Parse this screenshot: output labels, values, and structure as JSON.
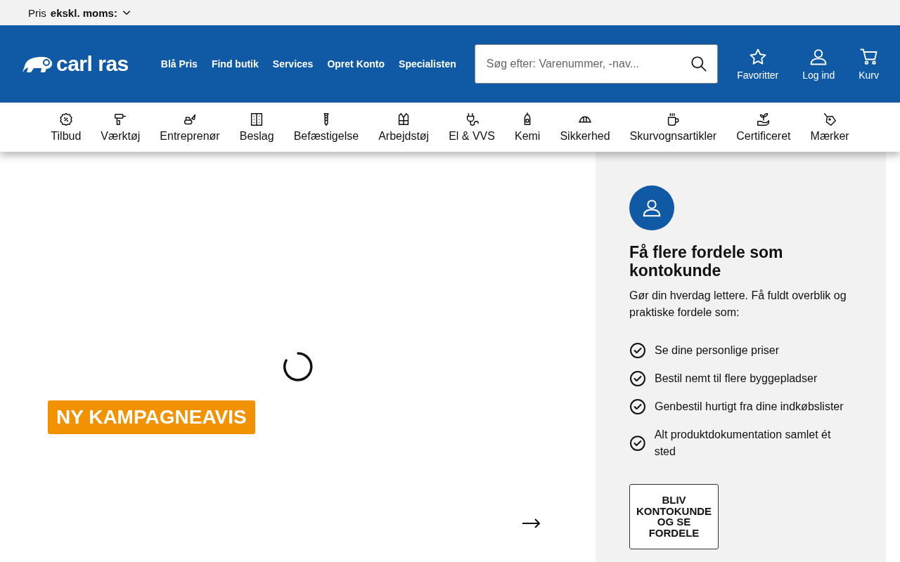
{
  "price_bar": {
    "label": "Pris",
    "value": "ekskl. moms:"
  },
  "header": {
    "logo": "carl ras",
    "links": [
      "Blå Pris",
      "Find butik",
      "Services",
      "Opret Konto",
      "Specialisten"
    ],
    "search": {
      "placeholder": "Søg efter: Varenummer, -nav..."
    },
    "actions": [
      "Favoritter",
      "Log ind",
      "Kurv"
    ]
  },
  "categories": [
    "Tilbud",
    "Værktøj",
    "Entreprenør",
    "Beslag",
    "Befæstigelse",
    "Arbejdstøj",
    "El & VVS",
    "Kemi",
    "Sikkerhed",
    "Skurvognsartikler",
    "Certificeret",
    "Mærker"
  ],
  "campaign": {
    "label": "NY KAMPAGNEAVIS"
  },
  "account_panel": {
    "title": "Få flere fordele som kontokunde",
    "intro": "Gør din hverdag lettere. Få fuldt overblik og praktiske fordele som:",
    "benefits": [
      "Se dine personlige priser",
      "Bestil nemt til flere byggepladser",
      "Genbestil hurtigt fra dine indkøbslister",
      "Alt produktdokumentation samlet ét sted"
    ],
    "button": "BLIV KONTOKUNDE OG SE FORDELE"
  }
}
